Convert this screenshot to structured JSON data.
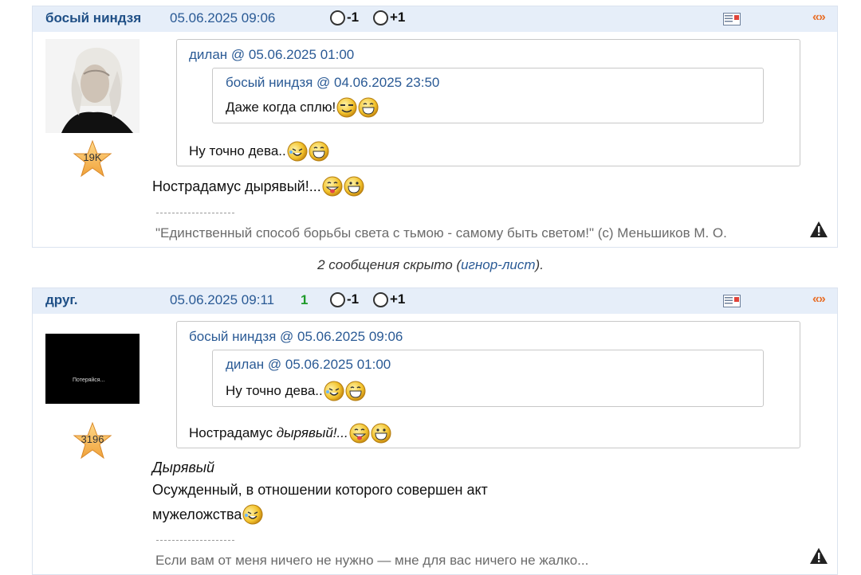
{
  "posts": [
    {
      "author": "босый ниндзя",
      "date": "05.06.2025 09:06",
      "rating_count": "",
      "vote_minus": "-1",
      "vote_plus": "+1",
      "quote_icon": "«»",
      "star_count": "19K",
      "quote": {
        "head": "дилан @ 05.06.2025 01:00",
        "nested": {
          "head": "босый ниндзя @ 04.06.2025 23:50",
          "text": "Даже когда сплю!"
        },
        "text": "Ну точно дева.."
      },
      "body": "Нострадамус дырявый!...",
      "signature": "\"Единственный способ борьбы света с тьмою - самому быть светом!\" (с) Меньшиков М. О."
    },
    {
      "author": "друг.",
      "date": "05.06.2025 09:11",
      "rating_count": "1",
      "vote_minus": "-1",
      "vote_plus": "+1",
      "quote_icon": "«»",
      "avatar_caption": "Потеряйся...",
      "star_count": "3196",
      "quote": {
        "head": "босый ниндзя @ 05.06.2025 09:06",
        "nested": {
          "head": "дилан @ 05.06.2025 01:00",
          "text": "Ну точно дева.."
        },
        "text_plain": "Нострадамус ",
        "text_italic": "дырявый!..."
      },
      "body_title": "Дырявый",
      "body_line1": "Осужденный, в отношении которого совершен акт",
      "body_line2": "мужеложства",
      "signature": "Если вам от меня ничего не нужно — мне для вас ничего не жалко..."
    }
  ],
  "hidden": {
    "prefix": "2 сообщения скрыто (",
    "link": "игнор-лист",
    "suffix": ")."
  },
  "colors": {
    "header_bg": "#e6eef9",
    "author": "#1f4f86",
    "link": "#2a5a95",
    "rating_green": "#1e9a2a",
    "quote_orange": "#e8702a",
    "star": "#f5b13a"
  },
  "icons": [
    "profile-card-icon",
    "quote-icon",
    "warning-icon",
    "rating-star-icon",
    "smiley-icon"
  ]
}
